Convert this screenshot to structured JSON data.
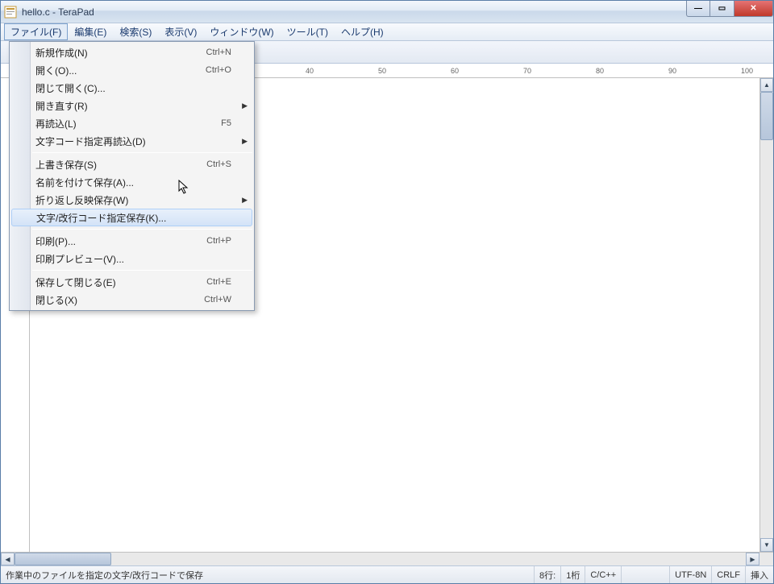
{
  "window": {
    "title": "hello.c - TeraPad"
  },
  "menubar": {
    "file": "ファイル(F)",
    "edit": "編集(E)",
    "search": "検索(S)",
    "view": "表示(V)",
    "window": "ウィンドウ(W)",
    "tool": "ツール(T)",
    "help": "ヘルプ(H)"
  },
  "file_menu": {
    "new": {
      "label": "新規作成(N)",
      "accel": "Ctrl+N"
    },
    "open": {
      "label": "開く(O)...",
      "accel": "Ctrl+O"
    },
    "open_close": {
      "label": "閉じて開く(C)..."
    },
    "reopen": {
      "label": "開き直す(R)"
    },
    "reload": {
      "label": "再読込(L)",
      "accel": "F5"
    },
    "reload_enc": {
      "label": "文字コード指定再読込(D)"
    },
    "save": {
      "label": "上書き保存(S)",
      "accel": "Ctrl+S"
    },
    "save_as": {
      "label": "名前を付けて保存(A)..."
    },
    "save_wrap": {
      "label": "折り返し反映保存(W)"
    },
    "save_enc": {
      "label": "文字/改行コード指定保存(K)..."
    },
    "print": {
      "label": "印刷(P)...",
      "accel": "Ctrl+P"
    },
    "print_preview": {
      "label": "印刷プレビュー(V)..."
    },
    "save_close": {
      "label": "保存して閉じる(E)",
      "accel": "Ctrl+E"
    },
    "close": {
      "label": "閉じる(X)",
      "accel": "Ctrl+W"
    }
  },
  "ruler": {
    "ticks": [
      40,
      50,
      60,
      70,
      80,
      90,
      100
    ]
  },
  "status": {
    "hint": "作業中のファイルを指定の文字/改行コードで保存",
    "line": "8行:",
    "col": "1桁",
    "mode": "C/C++",
    "encoding": "UTF-8N",
    "newline": "CRLF",
    "insert": "挿入"
  }
}
